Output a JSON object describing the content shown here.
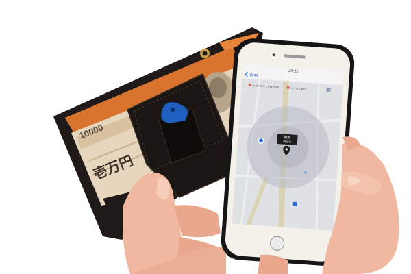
{
  "banknote": {
    "denomination": "10000",
    "kanji": "壱万円"
  },
  "phone": {
    "status_time": "20:11",
    "back_label": "財布",
    "place_labels": [
      "ヤマトヌマエビ株式会社",
      "ゆうちょ銀行"
    ],
    "popup_title": "財布",
    "popup_subtitle": "現在地"
  },
  "colors": {
    "wallet_leather": "#1f1a17",
    "wallet_lining": "#d9742f",
    "key_tag": "#1f5fbf",
    "phone_frame": "#151515",
    "phone_body": "#f4f0ea",
    "map_bg": "#dfe1e4",
    "range_circle": "#b6bac2",
    "skin": "#f0b8a0"
  }
}
